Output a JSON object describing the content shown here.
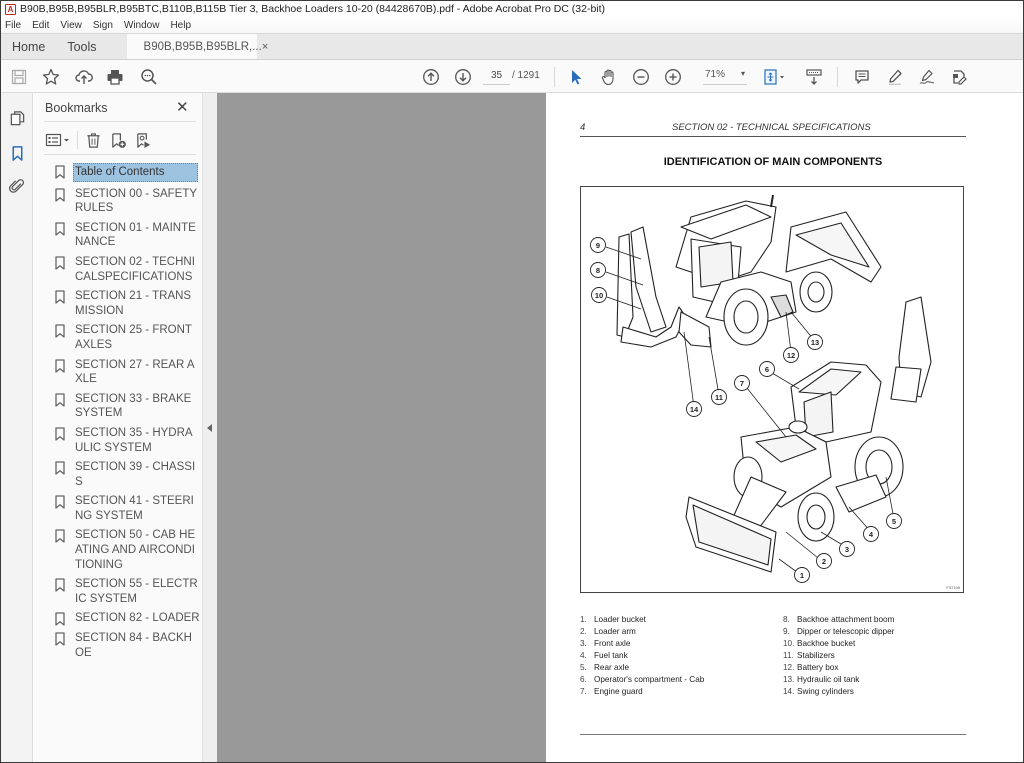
{
  "window": {
    "title": "B90B,B95B,B95BLR,B95BTC,B110B,B115B Tier 3, Backhoe Loaders 10-20 (84428670B).pdf - Adobe Acrobat Pro DC (32-bit)",
    "app_icon": "acrobat-icon"
  },
  "menu": [
    "File",
    "Edit",
    "View",
    "Sign",
    "Window",
    "Help"
  ],
  "tabs": {
    "home": "Home",
    "tools": "Tools",
    "document": "B90B,B95B,B95BLR,...",
    "close": "×"
  },
  "toolbar": {
    "left_icons": [
      "save-icon",
      "bookmark-star-icon",
      "upload-cloud-icon",
      "print-icon",
      "find-zoom-icon"
    ],
    "current_page": "35",
    "page_total": "/ 1291",
    "zoom_level": "71%",
    "zoom_caret": "▾",
    "right_icons": [
      "prev-page-icon",
      "next-page-icon",
      "select-cursor-icon",
      "hand-icon",
      "zoom-out-icon",
      "zoom-in-icon",
      "fit-page-icon",
      "scroll-mode-icon",
      "comment-icon",
      "highlight-icon",
      "sign-icon",
      "fill-sign-icon"
    ]
  },
  "rail": {
    "icons": [
      "page-thumbnails-icon",
      "bookmarks-icon",
      "attachments-icon"
    ],
    "active": "bookmarks-icon"
  },
  "bookmarks": {
    "title": "Bookmarks",
    "close": "✕",
    "tools": [
      "options-menu-icon",
      "delete-bookmark-icon",
      "add-bookmark-icon",
      "bookmark-properties-icon"
    ],
    "items": [
      {
        "label": "Table of Contents",
        "selected": true
      },
      {
        "label": "SECTION 00 - SAFETY RULES",
        "selected": false
      },
      {
        "label": "SECTION 01 - MAINTENANCE",
        "selected": false
      },
      {
        "label": "SECTION 02 - TECHNICALSPECIFICATIONS",
        "selected": false
      },
      {
        "label": "SECTION 21 - TRANSMISSION",
        "selected": false
      },
      {
        "label": "SECTION 25 - FRONT AXLES",
        "selected": false
      },
      {
        "label": "SECTION 27 - REAR AXLE",
        "selected": false
      },
      {
        "label": "SECTION 33 - BRAKE SYSTEM",
        "selected": false
      },
      {
        "label": "SECTION 35 - HYDRAULIC SYSTEM",
        "selected": false
      },
      {
        "label": "SECTION 39 - CHASSIS",
        "selected": false
      },
      {
        "label": "SECTION 41 - STEERING SYSTEM",
        "selected": false
      },
      {
        "label": "SECTION 50 - CAB HEATING AND AIRCONDITIONING",
        "selected": false
      },
      {
        "label": "SECTION 55 - ELECTRIC SYSTEM",
        "selected": false
      },
      {
        "label": "SECTION 82 - LOADER",
        "selected": false
      },
      {
        "label": "SECTION 84 - BACKHOE",
        "selected": false
      }
    ]
  },
  "page": {
    "number": "4",
    "section_header": "SECTION 02 - TECHNICAL SPECIFICATIONS",
    "heading": "IDENTIFICATION OF MAIN COMPONENTS",
    "figure_code": "F37199",
    "callouts": [
      "1",
      "2",
      "3",
      "4",
      "5",
      "6",
      "7",
      "8",
      "9",
      "10",
      "11",
      "12",
      "13",
      "14"
    ],
    "legend_left": [
      {
        "num": "1.",
        "text": "Loader bucket"
      },
      {
        "num": "2.",
        "text": "Loader arm"
      },
      {
        "num": "3.",
        "text": "Front axle"
      },
      {
        "num": "4.",
        "text": "Fuel tank"
      },
      {
        "num": "5.",
        "text": "Rear axle"
      },
      {
        "num": "6.",
        "text": "Operator's compartment - Cab"
      },
      {
        "num": "7.",
        "text": "Engine guard"
      }
    ],
    "legend_right": [
      {
        "num": "8.",
        "text": "Backhoe attachment boom"
      },
      {
        "num": "9.",
        "text": "Dipper or telescopic dipper"
      },
      {
        "num": "10.",
        "text": "Backhoe bucket"
      },
      {
        "num": "11.",
        "text": "Stabilizers"
      },
      {
        "num": "12.",
        "text": "Battery box"
      },
      {
        "num": "13.",
        "text": "Hydraulic oil tank"
      },
      {
        "num": "14.",
        "text": "Swing cylinders"
      }
    ]
  },
  "colors": {
    "selection": "#9ec3e1",
    "active_icon": "#2a6ebb",
    "doc_background": "#999999"
  }
}
